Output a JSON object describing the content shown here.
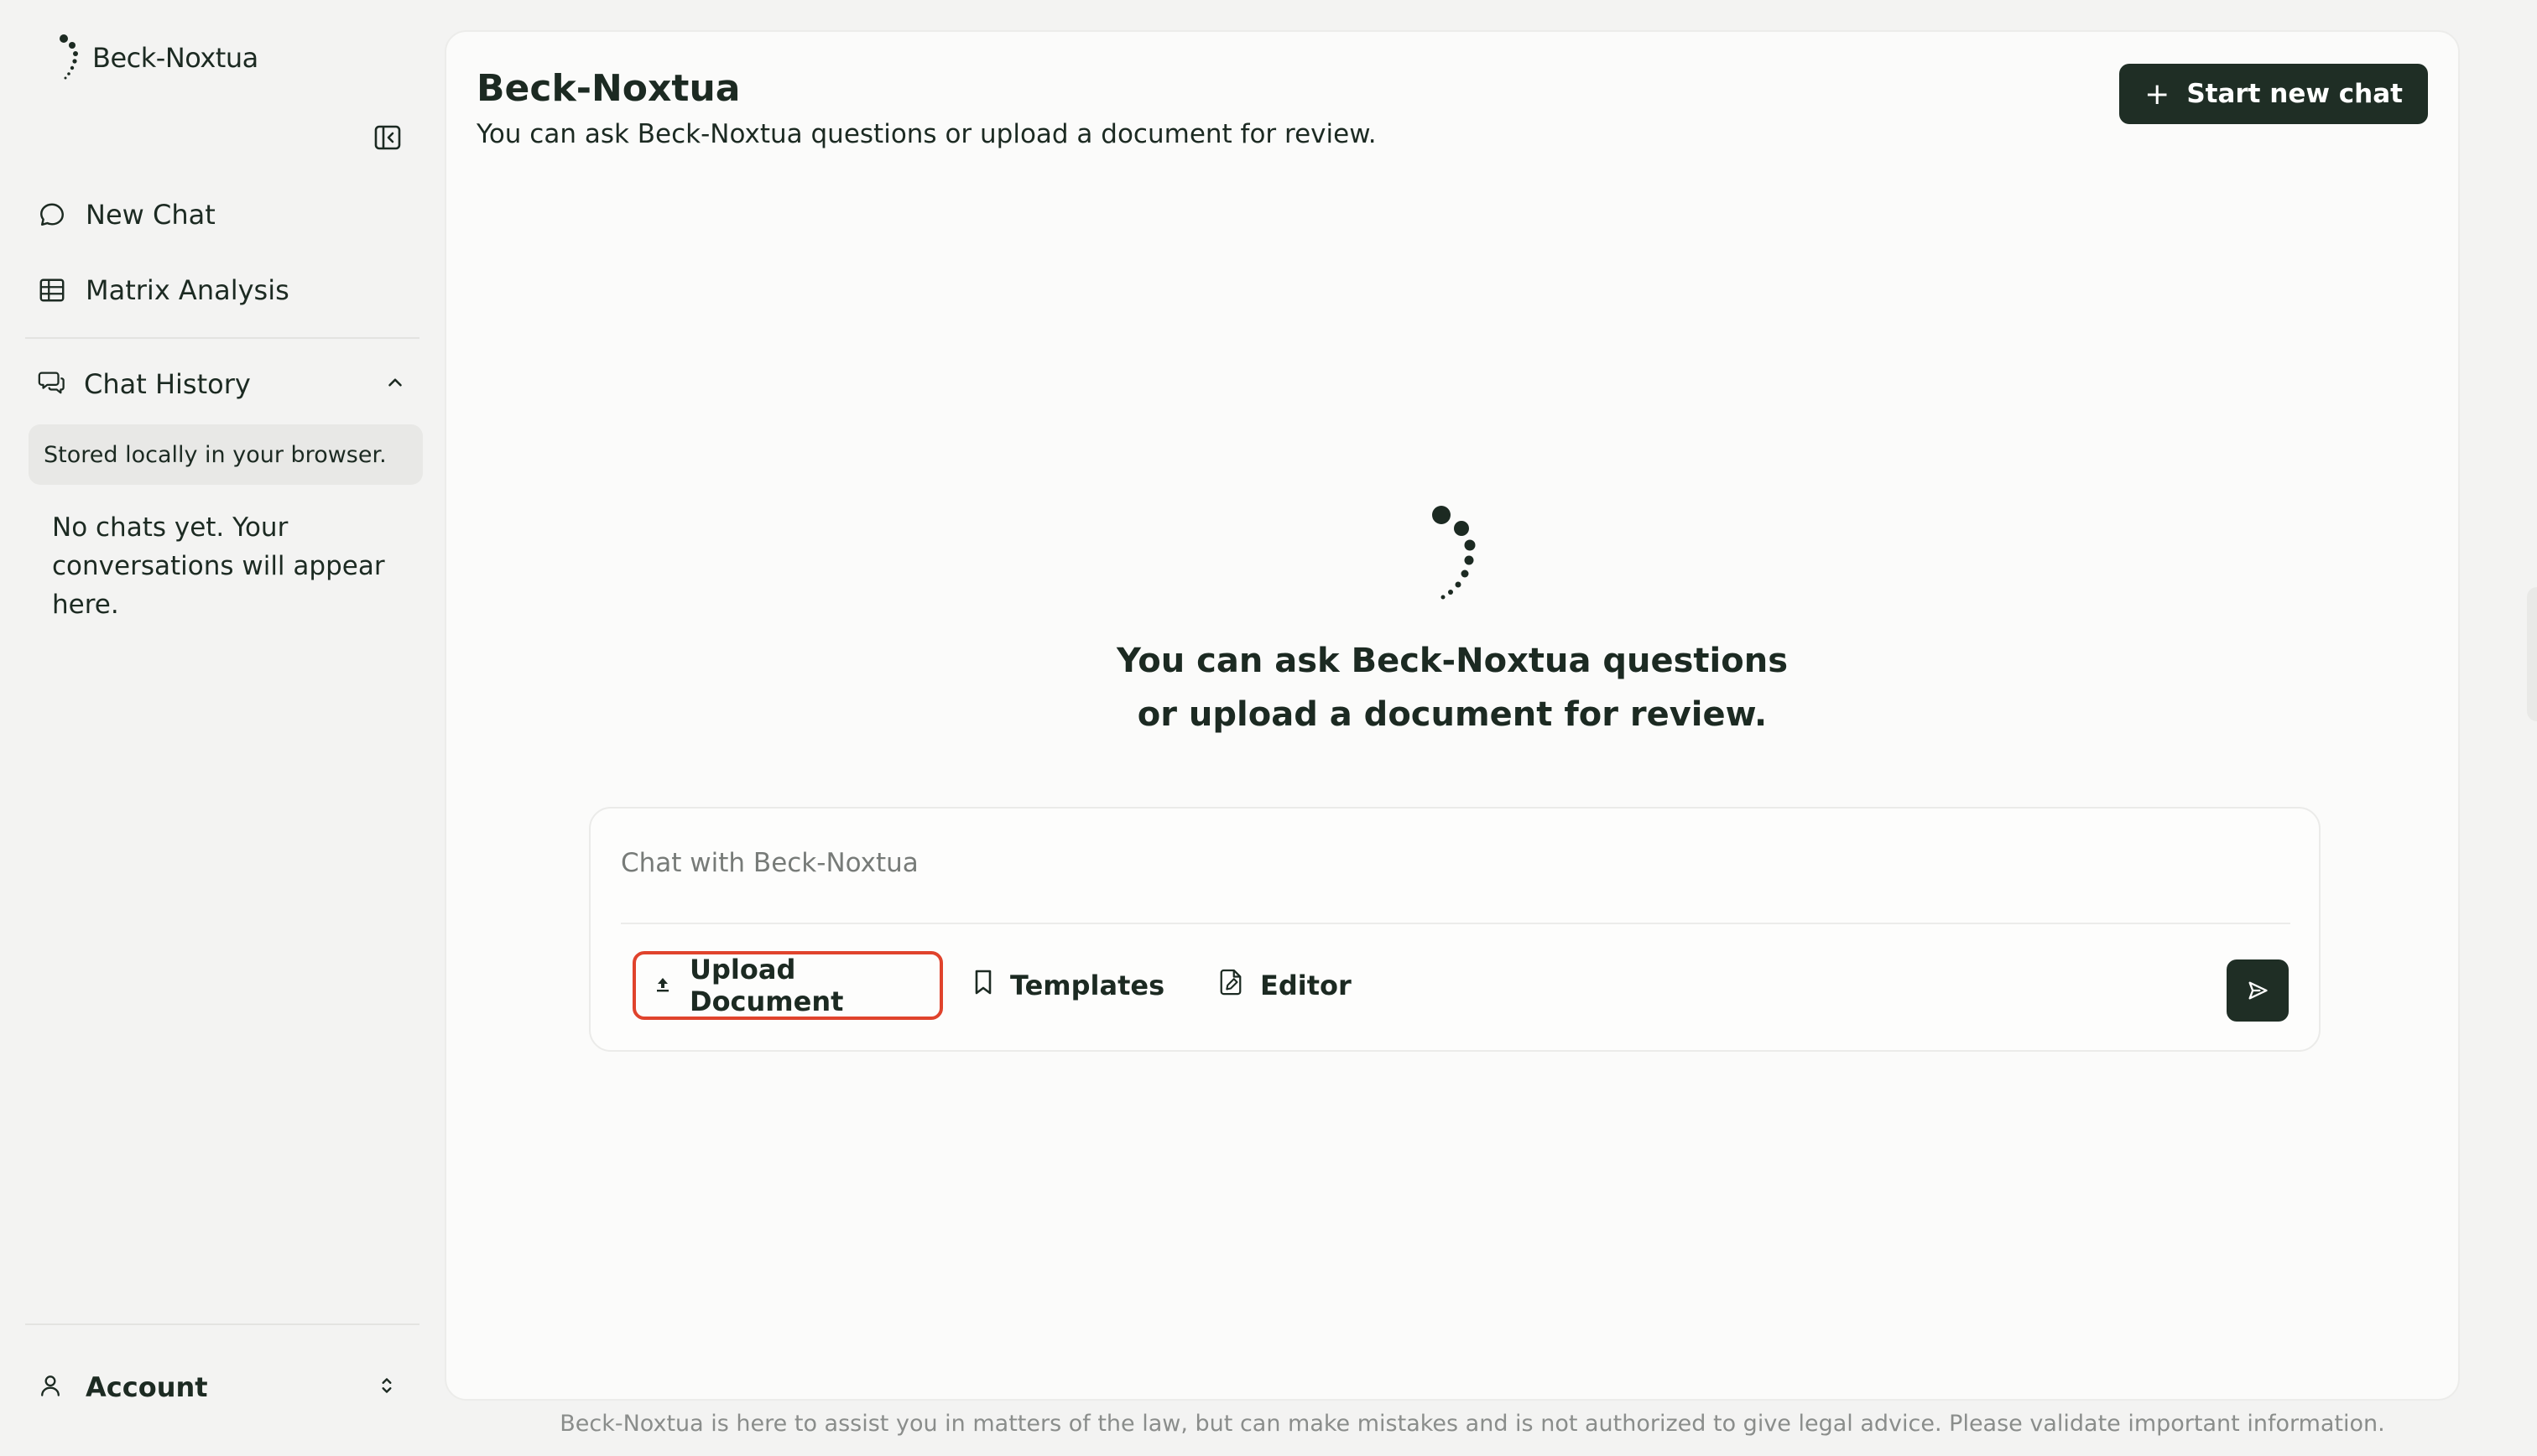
{
  "brand": {
    "name": "Beck-Noxtua"
  },
  "sidebar": {
    "nav": [
      {
        "label": "New Chat",
        "icon": "chat-bubble-icon"
      },
      {
        "label": "Matrix Analysis",
        "icon": "table-grid-icon"
      }
    ],
    "history": {
      "label": "Chat History",
      "note": "Stored locally in your browser.",
      "empty": "No chats yet. Your conversations will appear here."
    },
    "account": {
      "label": "Account"
    }
  },
  "main": {
    "title": "Beck-Noxtua",
    "subtitle": "You can ask Beck-Noxtua questions or upload a document for review.",
    "start_button": "Start new chat",
    "hero_line1": "You can ask Beck-Noxtua questions",
    "hero_line2": "or upload a document for review."
  },
  "composer": {
    "placeholder": "Chat with Beck-Noxtua",
    "upload_label": "Upload Document",
    "templates_label": "Templates",
    "editor_label": "Editor"
  },
  "footer": {
    "disclaimer": "Beck-Noxtua is here to assist you in matters of the law, but can make mistakes and is not authorized to give legal advice. Please validate important information."
  },
  "colors": {
    "accent": "#1f2e25",
    "highlight": "#e0432c",
    "background": "#f3f3f2"
  }
}
